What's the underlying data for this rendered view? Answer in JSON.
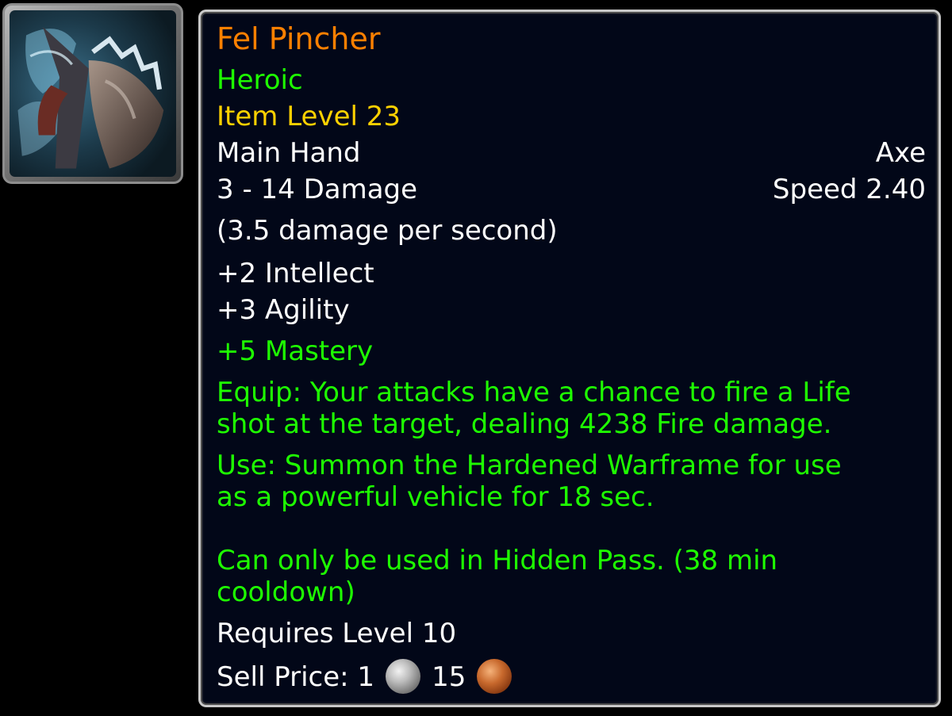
{
  "item": {
    "icon": "fel-pincher-axe-icon",
    "name": "Fel Pincher",
    "difficulty": "Heroic",
    "item_level": "Item Level 23",
    "slot": "Main Hand",
    "weapon_type": "Axe",
    "damage": "3 - 14 Damage",
    "speed": "Speed 2.40",
    "dps": "(3.5 damage per second)",
    "stats": {
      "intellect": "+2 Intellect",
      "agility": "+3 Agility",
      "mastery": "+5 Mastery"
    },
    "equip_line1": "Equip: Your attacks have a chance to fire a Life",
    "equip_line2": "shot at the target, dealing 4238 Fire damage.",
    "use_line1": "Use: Summon the Hardened Warframe for use",
    "use_line2": "as a powerful vehicle for 18 sec.",
    "restriction_line1": "Can only be used in Hidden Pass. (38 min",
    "restriction_line2": "cooldown)",
    "requirement": "Requires Level 10",
    "sell_price": {
      "label": "Sell Price:",
      "silver": "1",
      "copper": "15",
      "silver_icon": "silver-coin-icon",
      "copper_icon": "copper-coin-icon"
    }
  },
  "colors": {
    "legendary_orange": "#ff8000",
    "heroic_green": "#1eff00",
    "item_level_yellow": "#ffd100",
    "text_white": "#ffffff",
    "tooltip_background": "#020718",
    "tooltip_border": "#c9c9c9"
  }
}
